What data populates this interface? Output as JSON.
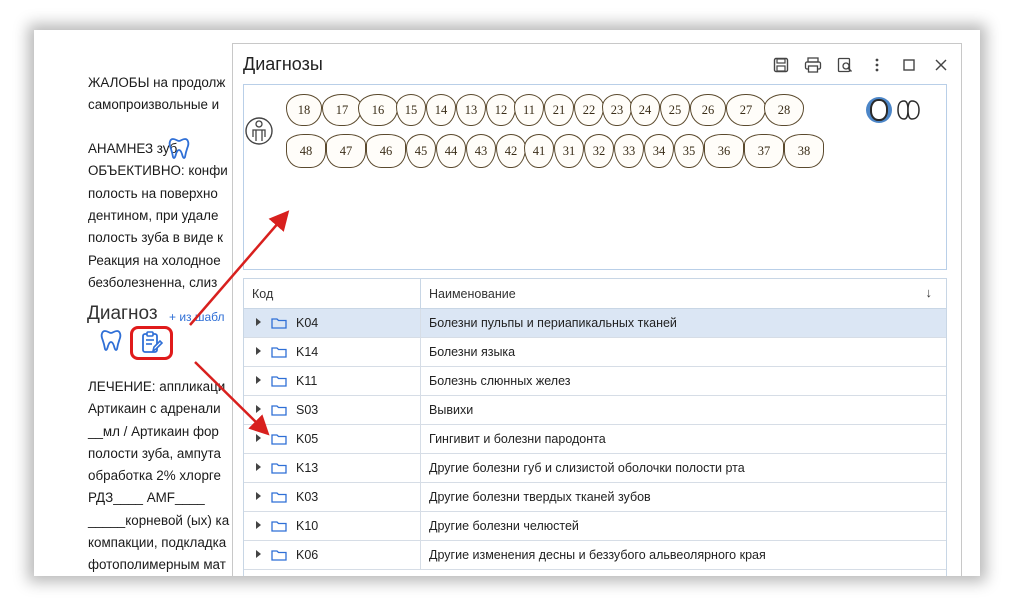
{
  "document": {
    "lines": [
      "ЖАЛОБЫ на продолж",
      "самопроизвольные и",
      "",
      "АНАМНЕЗ          зуб",
      "ОБЪЕКТИВНО: конфи",
      "полость на  поверхно",
      "дентином,  при удале",
      "полость зуба в виде к",
      "Реакция на холодное",
      "безболезненна, слиз"
    ],
    "diagnosis_heading": "Диагноз",
    "from_template_link": "+ из шабл",
    "lines_after": [
      "ЛЕЧЕНИЕ: аппликаци",
      "Артикаин с адренали",
      "__мл  / Артикаин фор",
      "полости зуба, ампута",
      "обработка   2% хлорге",
      "РДЗ____    AMF____",
      "_____корневой (ых) ка",
      "компакции, подкладка",
      "фотополимерным мат"
    ]
  },
  "dialog": {
    "title": "Диагнозы",
    "tools": [
      "save-icon",
      "print-icon",
      "preview-icon",
      "more-icon",
      "maximize-icon",
      "close-icon"
    ],
    "upper_teeth": [
      "18",
      "17",
      "16",
      "15",
      "14",
      "13",
      "12",
      "11",
      "21",
      "22",
      "23",
      "24",
      "25",
      "26",
      "27",
      "28"
    ],
    "lower_teeth": [
      "48",
      "47",
      "46",
      "45",
      "44",
      "43",
      "42",
      "41",
      "31",
      "32",
      "33",
      "34",
      "35",
      "36",
      "37",
      "38"
    ],
    "table": {
      "col_code": "Код",
      "col_name": "Наименование",
      "sort_glyph": "↓",
      "rows": [
        {
          "code": "K04",
          "name": "Болезни пульпы и периапикальных тканей",
          "selected": true
        },
        {
          "code": "K14",
          "name": "Болезни языка",
          "selected": false
        },
        {
          "code": "K11",
          "name": "Болезнь слюнных желез",
          "selected": false
        },
        {
          "code": "S03",
          "name": "Вывихи",
          "selected": false
        },
        {
          "code": "K05",
          "name": "Гингивит и болезни пародонта",
          "selected": false
        },
        {
          "code": "K13",
          "name": "Другие болезни губ и слизистой оболочки полости рта",
          "selected": false
        },
        {
          "code": "K03",
          "name": "Другие болезни твердых тканей зубов",
          "selected": false
        },
        {
          "code": "K10",
          "name": "Другие болезни челюстей",
          "selected": false
        },
        {
          "code": "K06",
          "name": "Другие изменения десны и беззубого альвеолярного края",
          "selected": false
        }
      ]
    }
  },
  "colors": {
    "accent": "#2f6fd6",
    "highlight": "#e01b1b",
    "selected_row": "#dbe6f4",
    "folder": "#2f6fd6"
  }
}
